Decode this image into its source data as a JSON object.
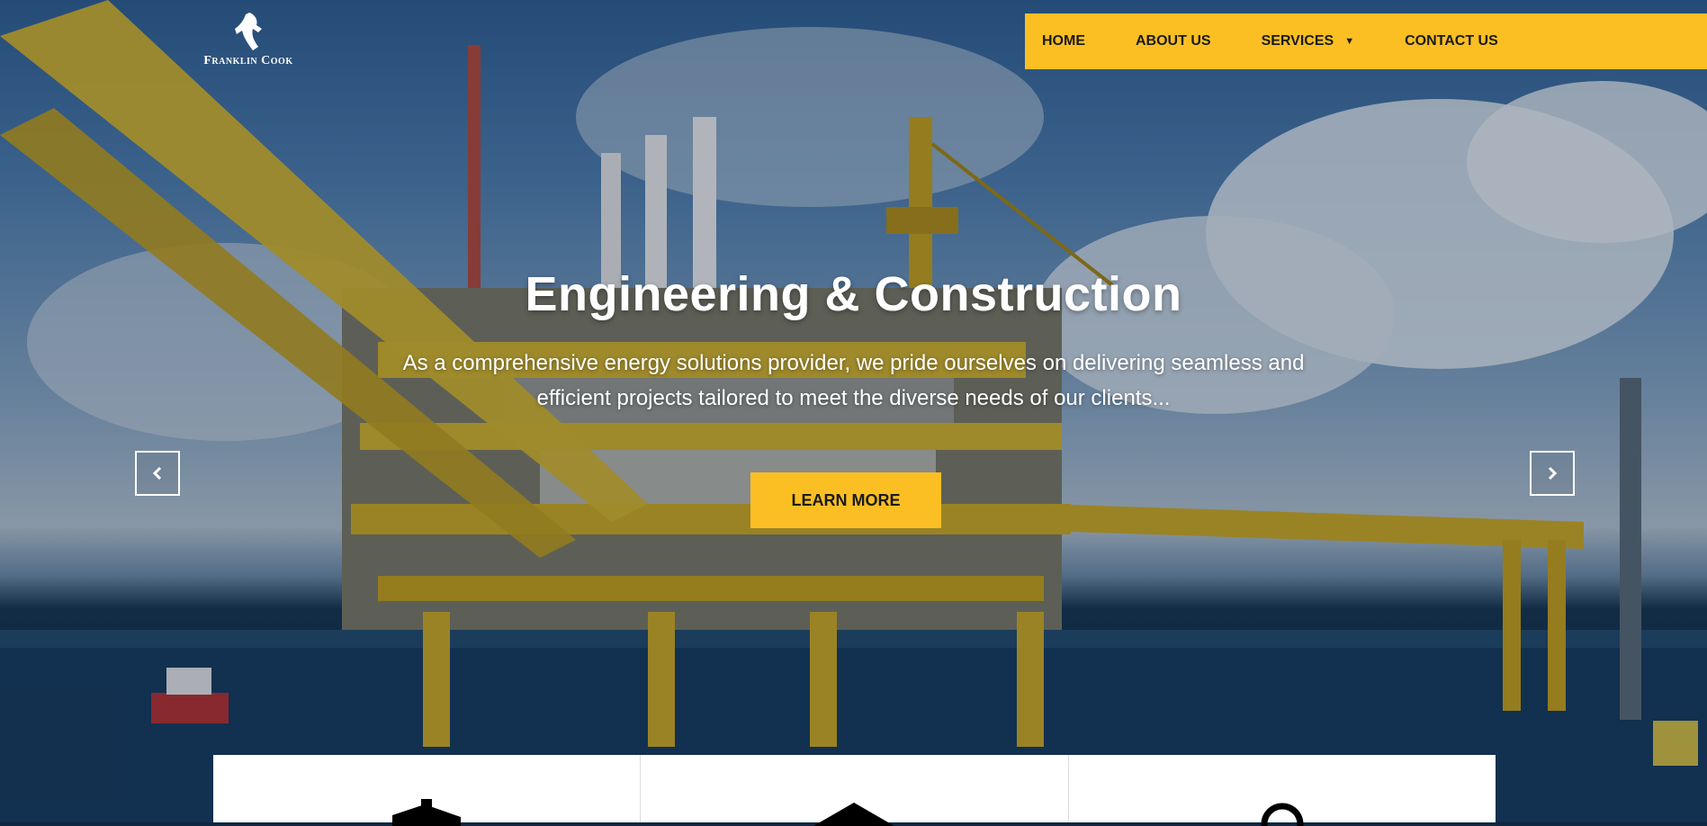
{
  "brand": {
    "name": "Franklin Cook",
    "logo_icon": "horse-icon"
  },
  "nav": {
    "items": [
      {
        "label": "HOME"
      },
      {
        "label": "ABOUT US"
      },
      {
        "label": "SERVICES",
        "has_dropdown": true
      },
      {
        "label": "CONTACT US"
      }
    ],
    "background": "#fbbf24"
  },
  "hero": {
    "title": "Engineering & Construction",
    "subtitle": "As a comprehensive energy solutions provider, we pride ourselves on delivering seamless and efficient projects tailored to meet the diverse needs of our clients...",
    "cta_label": "LEARN MORE",
    "prev_icon": "chevron-left-icon",
    "next_icon": "chevron-right-icon"
  },
  "cards": [
    {
      "icon": "helmet-icon"
    },
    {
      "icon": "roof-icon"
    },
    {
      "icon": "pin-icon"
    }
  ],
  "colors": {
    "accent": "#fbbf24",
    "text_dark": "#1a1a1a",
    "text_light": "#ffffff"
  }
}
